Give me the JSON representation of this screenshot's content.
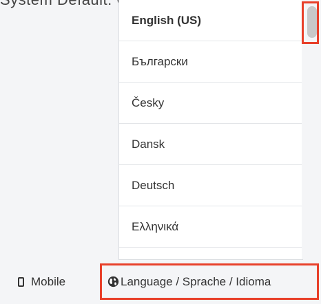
{
  "header": {
    "clipped_text": "System Default: Cancel"
  },
  "language_dropdown": {
    "items": [
      {
        "label": "English (US)",
        "selected": true
      },
      {
        "label": "Български",
        "selected": false
      },
      {
        "label": "Česky",
        "selected": false
      },
      {
        "label": "Dansk",
        "selected": false
      },
      {
        "label": "Deutsch",
        "selected": false
      },
      {
        "label": "Ελληνικά",
        "selected": false
      }
    ]
  },
  "footer": {
    "mobile_label": "Mobile",
    "language_label": "Language / Sprache / Idioma"
  },
  "colors": {
    "highlight": "#e8402a",
    "scroll_thumb": "#c8c8c8"
  }
}
